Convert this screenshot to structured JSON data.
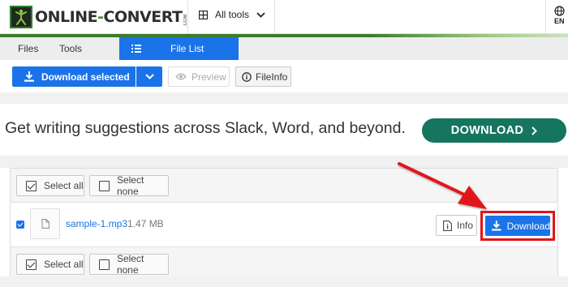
{
  "header": {
    "logo_text_left": "ONLINE",
    "logo_text_dash": "-",
    "logo_text_right": "CONVERT",
    "logo_suffix": ".COM",
    "all_tools_label": "All tools",
    "language": "EN",
    "icons": [
      "grid-icon",
      "chevron-down-icon",
      "globe-icon"
    ]
  },
  "tabs": {
    "files": "Files",
    "tools": "Tools",
    "file_list": "File List"
  },
  "toolbar": {
    "download_selected": "Download selected",
    "preview": "Preview",
    "fileinfo": "FileInfo"
  },
  "ad": {
    "text": "Get writing suggestions across Slack, Word, and beyond.",
    "button": "DOWNLOAD",
    "button_color": "#15755f"
  },
  "panel": {
    "select_all": "Select all",
    "select_none": "Select none",
    "files": [
      {
        "name": "sample-1.mp3",
        "size": "1.47 MB",
        "checked": true,
        "info_label": "Info",
        "download_label": "Download"
      }
    ]
  },
  "colors": {
    "accent": "#1a73e8",
    "highlight": "#e1141b",
    "brand_green": "#3a7d2c"
  }
}
